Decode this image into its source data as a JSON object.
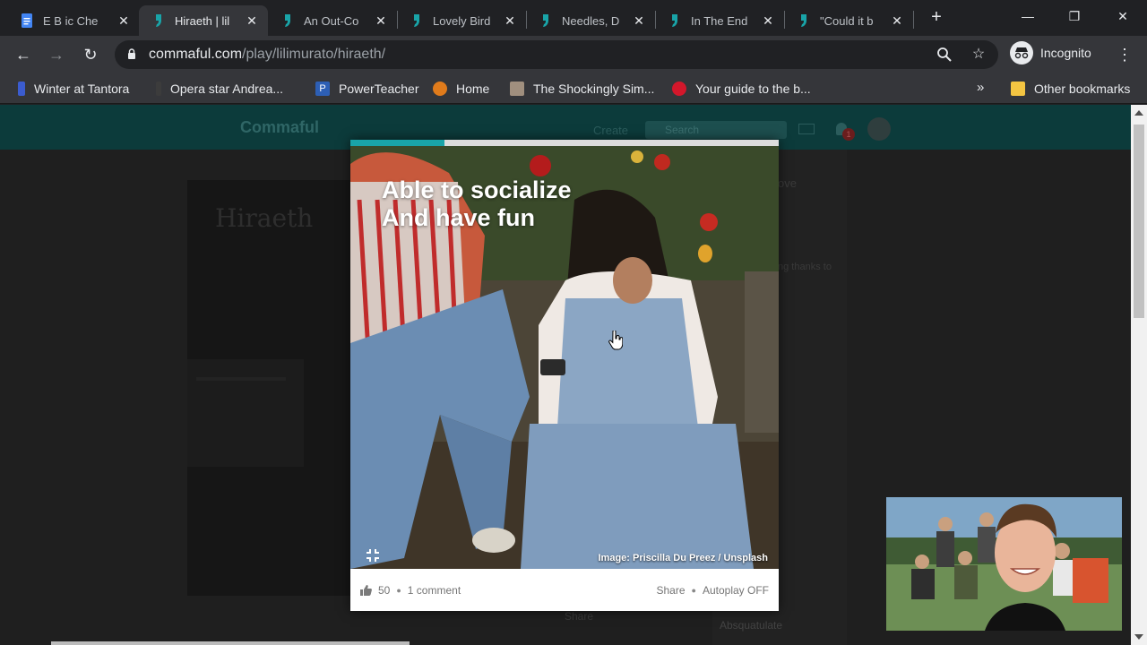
{
  "browser": {
    "tabs": [
      {
        "title": "E B ic Che",
        "favicon": "docs-icon",
        "active": false
      },
      {
        "title": "Hiraeth | lil",
        "favicon": "commaful-icon",
        "active": true
      },
      {
        "title": "An Out-Co",
        "favicon": "commaful-icon",
        "active": false
      },
      {
        "title": "Lovely Bird",
        "favicon": "commaful-icon",
        "active": false
      },
      {
        "title": "Needles, D",
        "favicon": "commaful-icon",
        "active": false
      },
      {
        "title": "In The End",
        "favicon": "commaful-icon",
        "active": false
      },
      {
        "title": "\"Could it b",
        "favicon": "commaful-icon",
        "active": false
      }
    ],
    "url_host": "commaful.com",
    "url_path": "/play/lilimurato/hiraeth/",
    "profile_label": "Incognito",
    "bookmarks": [
      {
        "label": "Winter at Tantora",
        "icon": "bookmark-icon"
      },
      {
        "label": "Opera star Andrea...",
        "icon": "bookmark-icon"
      },
      {
        "label": "PowerTeacher",
        "icon": "powerteacher-icon"
      },
      {
        "label": "Home",
        "icon": "home-icon"
      },
      {
        "label": "The Shockingly Sim...",
        "icon": "bookmark-icon"
      },
      {
        "label": "Your guide to the b...",
        "icon": "bookmark-icon"
      }
    ],
    "bookmarks_overflow": "»",
    "other_bookmarks": "Other bookmarks"
  },
  "site": {
    "logo": "Commaful",
    "create": "Create",
    "search_placeholder": "Search",
    "notif_count": "1",
    "background_title": "Hiraeth",
    "bg_right_texts": [
      "ove",
      "ng thanks to",
      "Absquatulate"
    ],
    "bg_footer": "Share"
  },
  "story": {
    "progress": 0.22,
    "caption_lines": [
      "Able to socialize",
      "And have fun"
    ],
    "image_credit": "Image: Priscilla Du Preez / Unsplash",
    "likes": "50",
    "comments": "1 comment",
    "share": "Share",
    "autoplay": "Autoplay OFF"
  },
  "colors": {
    "accent": "#19a4a8",
    "chrome_dark": "#202124",
    "chrome_mid": "#35363a"
  }
}
